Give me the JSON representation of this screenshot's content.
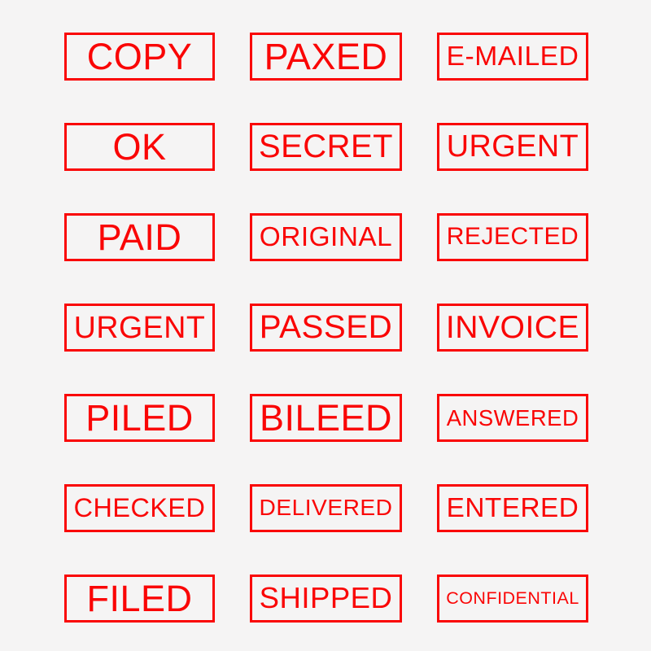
{
  "sheet": {
    "title": "Rubber Stamp Label Set",
    "background_color": "#f5f4f4",
    "stamp_color": "#fa0505",
    "border_width_px": 3,
    "columns": 3,
    "rows": 7,
    "total_stamps": 21
  },
  "stamps": [
    {
      "id": "stamp-copy",
      "label": "COPY",
      "row": 1,
      "column": 1
    },
    {
      "id": "stamp-paxed",
      "label": "PAXED",
      "row": 1,
      "column": 2
    },
    {
      "id": "stamp-e-mailed",
      "label": "E-MAILED",
      "row": 1,
      "column": 3
    },
    {
      "id": "stamp-ok",
      "label": "OK",
      "row": 2,
      "column": 1
    },
    {
      "id": "stamp-secret",
      "label": "SECRET",
      "row": 2,
      "column": 2
    },
    {
      "id": "stamp-urgent-1",
      "label": "URGENT",
      "row": 2,
      "column": 3
    },
    {
      "id": "stamp-paid",
      "label": "PAID",
      "row": 3,
      "column": 1
    },
    {
      "id": "stamp-original",
      "label": "ORIGINAL",
      "row": 3,
      "column": 2
    },
    {
      "id": "stamp-rejected",
      "label": "REJECTED",
      "row": 3,
      "column": 3
    },
    {
      "id": "stamp-urgent-2",
      "label": "URGENT",
      "row": 4,
      "column": 1
    },
    {
      "id": "stamp-passed",
      "label": "PASSED",
      "row": 4,
      "column": 2
    },
    {
      "id": "stamp-invoice",
      "label": "INVOICE",
      "row": 4,
      "column": 3
    },
    {
      "id": "stamp-piled",
      "label": "PILED",
      "row": 5,
      "column": 1
    },
    {
      "id": "stamp-bileed",
      "label": "BILEED",
      "row": 5,
      "column": 2
    },
    {
      "id": "stamp-answered",
      "label": "ANSWERED",
      "row": 5,
      "column": 3
    },
    {
      "id": "stamp-checked",
      "label": "CHECKED",
      "row": 6,
      "column": 1
    },
    {
      "id": "stamp-delivered",
      "label": "DELIVERED",
      "row": 6,
      "column": 2
    },
    {
      "id": "stamp-entered",
      "label": "ENTERED",
      "row": 6,
      "column": 3
    },
    {
      "id": "stamp-filed",
      "label": "FILED",
      "row": 7,
      "column": 1
    },
    {
      "id": "stamp-shipped",
      "label": "SHIPPED",
      "row": 7,
      "column": 2
    },
    {
      "id": "stamp-confidential",
      "label": "CONFIDENTIAL",
      "row": 7,
      "column": 3
    }
  ]
}
